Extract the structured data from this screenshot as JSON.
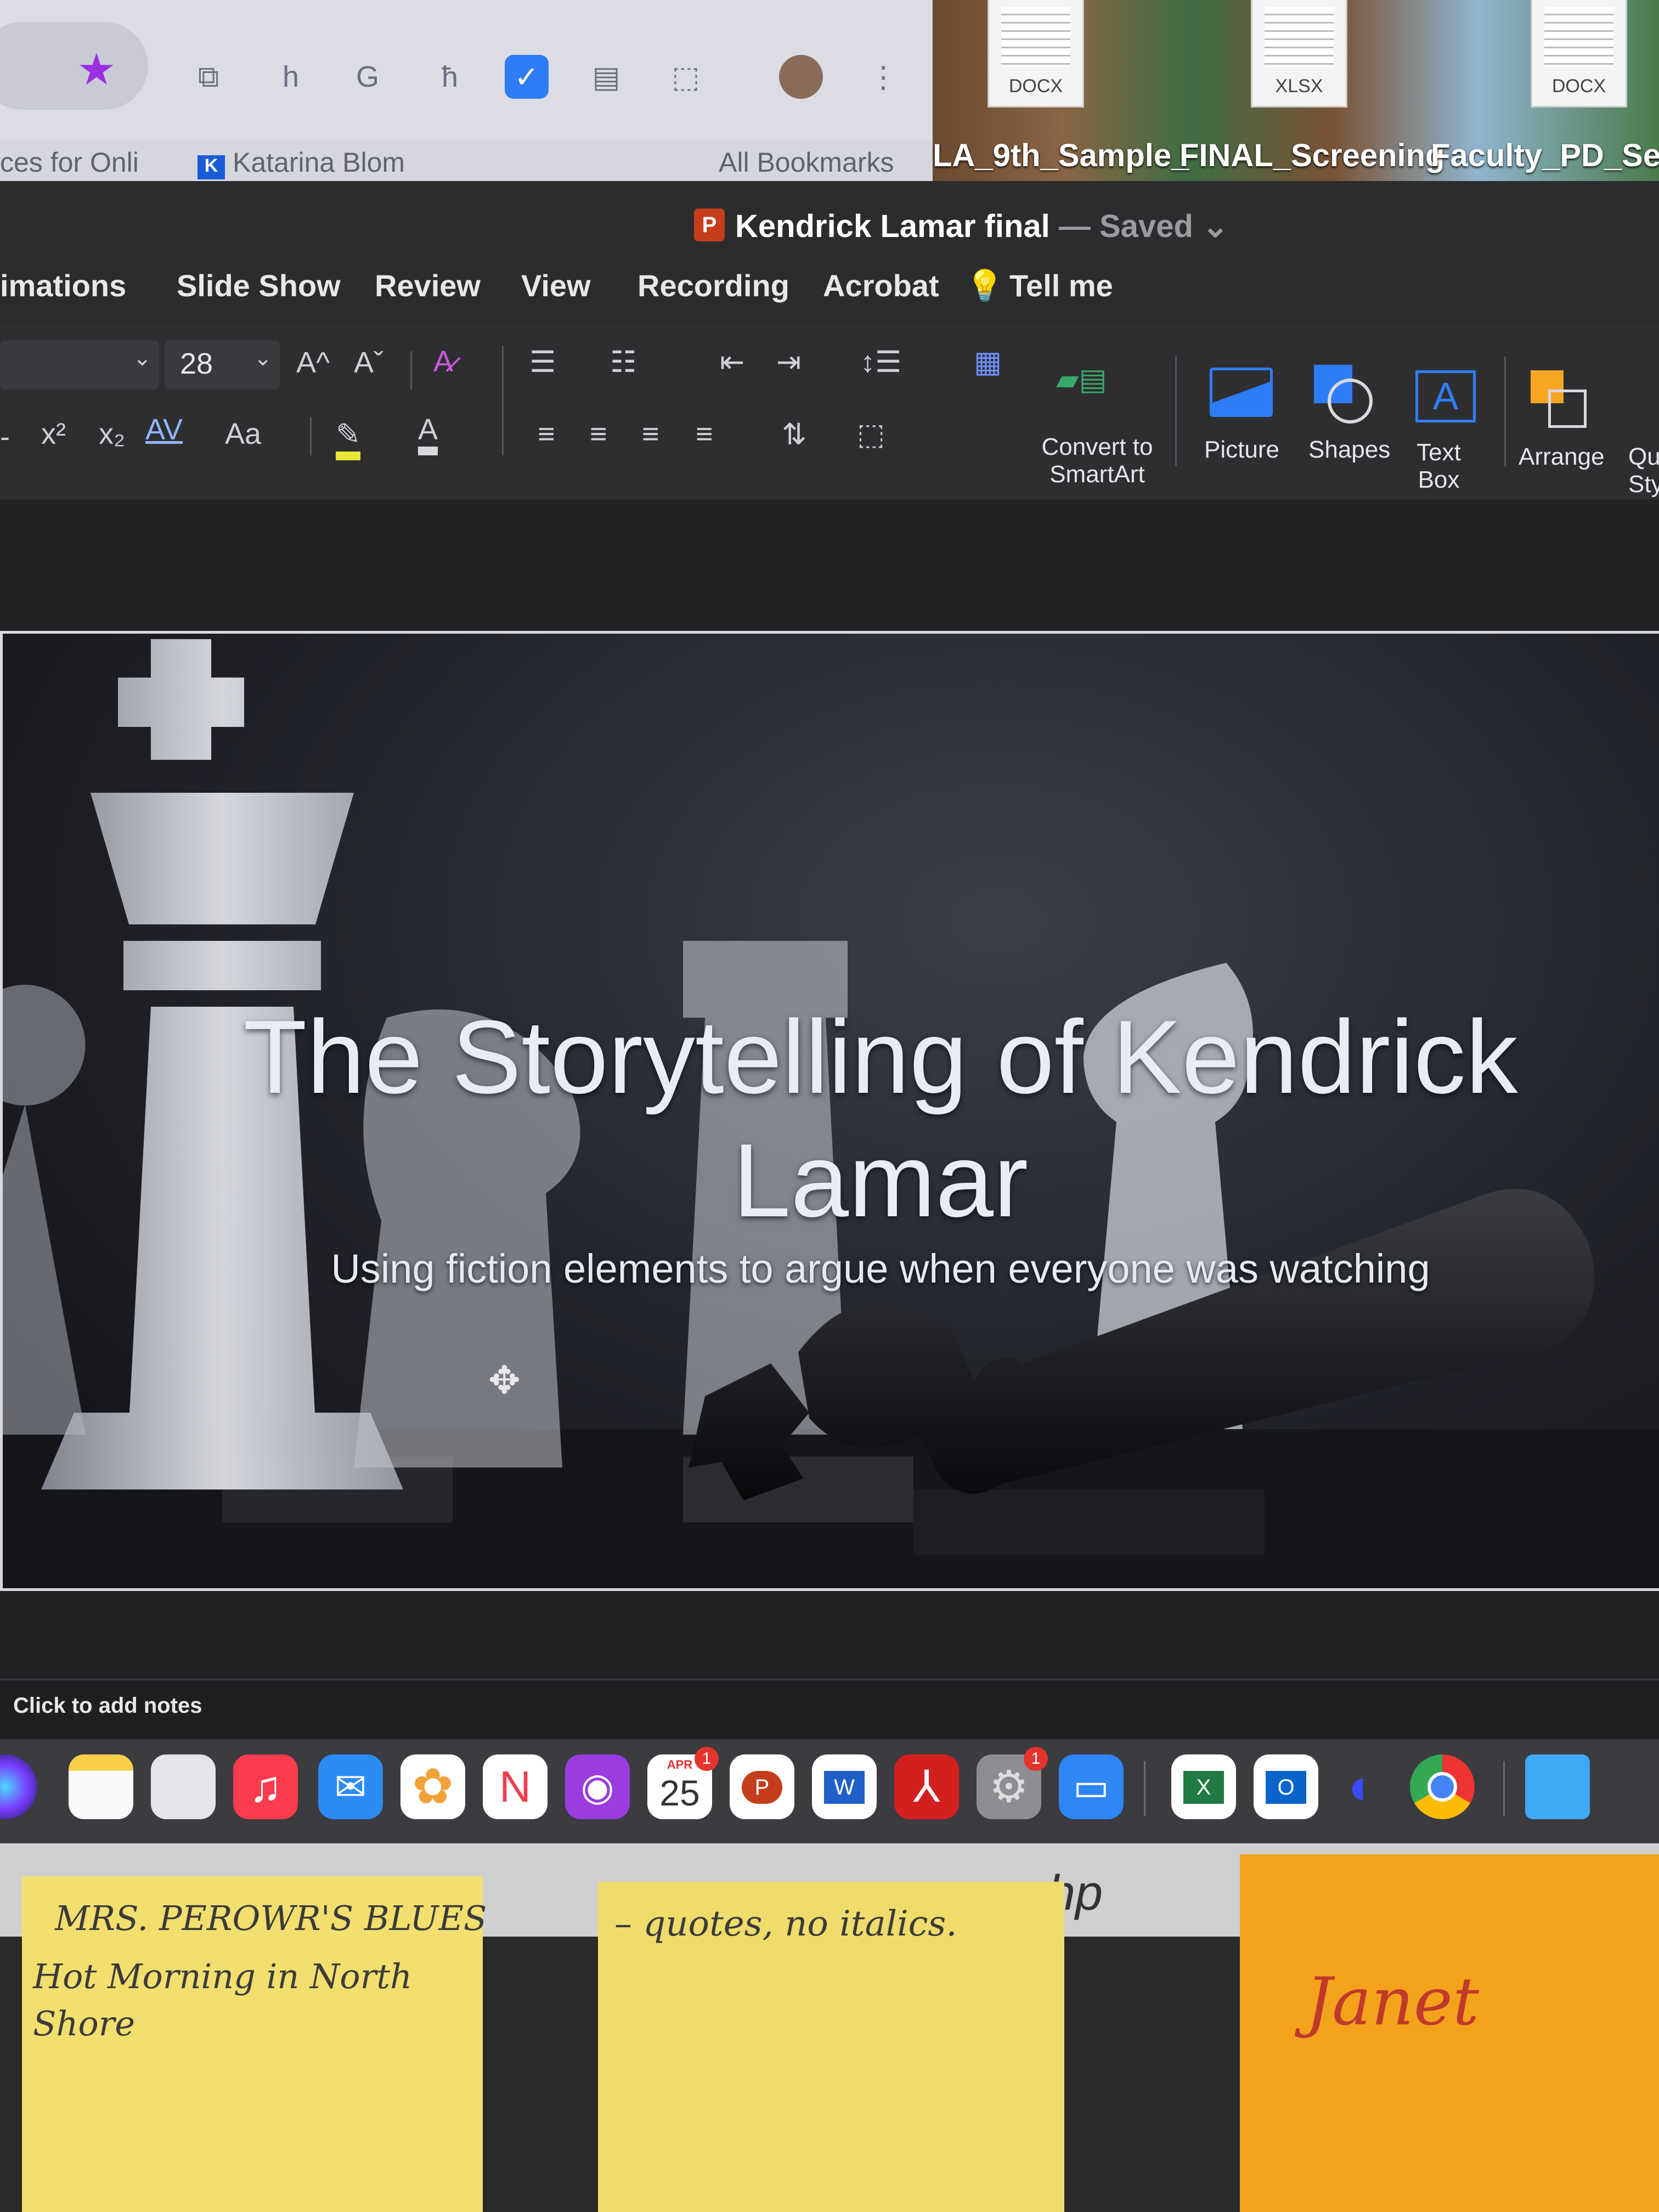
{
  "browser": {
    "bookmarks": [
      "ces for Onli",
      "Katarina Blom",
      "All Bookmarks"
    ]
  },
  "desktop": {
    "files": [
      {
        "type": "DOCX",
        "name": "LA_9th_Sample_"
      },
      {
        "type": "XLSX",
        "name": "FINAL_Screening"
      },
      {
        "type": "DOCX",
        "name": "Faculty_PD_Sessi"
      }
    ]
  },
  "window": {
    "title": "Kendrick Lamar final",
    "status": "— Saved"
  },
  "tabs": [
    "imations",
    "Slide Show",
    "Review",
    "View",
    "Recording",
    "Acrobat",
    "Tell me"
  ],
  "ribbon": {
    "font_size": "28",
    "grow_font": "A^",
    "shrink_font": "Aˇ",
    "superscript": "x²",
    "subscript": "x₂",
    "spacing": "AV",
    "change_case": "Aa",
    "convert_smartart": "Convert to SmartArt",
    "picture": "Picture",
    "shapes": "Shapes",
    "text_box": "Text Box",
    "arrange": "Arrange",
    "quick_styles": "Qu Sty"
  },
  "slide": {
    "title": "The Storytelling of Kendrick Lamar",
    "subtitle": "Using fiction elements to argue when everyone was watching"
  },
  "notes": {
    "placeholder": "Click to add notes"
  },
  "dock": {
    "calendar_month": "APR",
    "calendar_day": "25",
    "calendar_badge": "1",
    "settings_badge": "1"
  },
  "monitor": {
    "brand": "hp"
  },
  "sticky_notes": {
    "left_line1": "MRS. PEROWR'S BLUES",
    "left_line2": "Hot Morning in North Shore",
    "middle": "– quotes, no italics.",
    "right": "Janet"
  },
  "colors": {
    "ppt_red": "#c43e1c",
    "accent_blue": "#2f7df6",
    "sticky_yellow": "#f2df6e",
    "sticky_orange": "#f4a21b"
  }
}
